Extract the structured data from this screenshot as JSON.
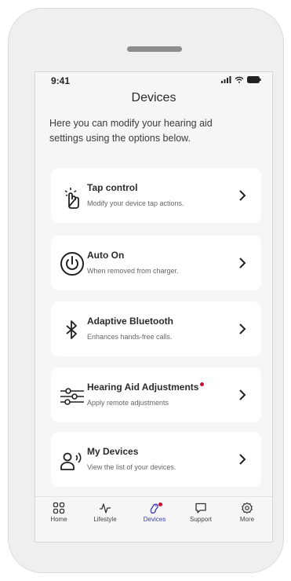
{
  "status": {
    "time": "9:41"
  },
  "page": {
    "title": "Devices",
    "intro": "Here you can modify your hearing aid settings using the options below."
  },
  "items": [
    {
      "icon": "tap-gesture-icon",
      "title": "Tap control",
      "subtitle": "Modify your device tap actions.",
      "has_badge": false
    },
    {
      "icon": "power-icon",
      "title": "Auto On",
      "subtitle": "When removed from charger.",
      "has_badge": false
    },
    {
      "icon": "bluetooth-icon",
      "title": "Adaptive Bluetooth",
      "subtitle": "Enhances hands-free calls.",
      "has_badge": false
    },
    {
      "icon": "sliders-icon",
      "title": "Hearing Aid Adjustments",
      "subtitle": "Apply remote adjustments",
      "has_badge": true
    },
    {
      "icon": "person-sound-icon",
      "title": "My Devices",
      "subtitle": "View the list of your devices.",
      "has_badge": false
    }
  ],
  "tabbar": {
    "tabs": [
      {
        "label": "Home",
        "icon": "grid-icon"
      },
      {
        "label": "Lifestyle",
        "icon": "pulse-icon"
      },
      {
        "label": "Devices",
        "icon": "hearing-aid-icon",
        "active": true,
        "has_badge": true
      },
      {
        "label": "Support",
        "icon": "chat-bubble-icon"
      },
      {
        "label": "More",
        "icon": "gear-icon"
      }
    ]
  },
  "colors": {
    "accent": "#3a3ab8",
    "badge": "#c8102e",
    "card": "#ffffff",
    "background": "#f6f6f6"
  }
}
